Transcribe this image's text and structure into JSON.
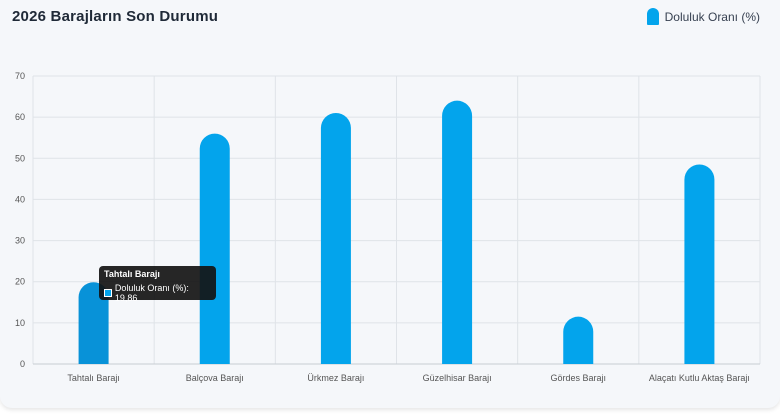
{
  "header": {
    "title": "2026 Barajların Son Durumu"
  },
  "legend": {
    "label": "Doluluk Oranı (%)",
    "color": "#03a4ec"
  },
  "tooltip": {
    "title": "Tahtalı Barajı",
    "row": "Doluluk Oranı (%): 19,86"
  },
  "chart_data": {
    "type": "bar",
    "categories": [
      "Tahtalı Barajı",
      "Balçova Barajı",
      "Ürkmez Barajı",
      "Güzelhisar Barajı",
      "Gördes Barajı",
      "Alaçatı Kutlu Aktaş Barajı"
    ],
    "series": [
      {
        "name": "Doluluk Oranı (%)",
        "values": [
          19.86,
          56,
          61,
          64,
          11.5,
          48.5
        ]
      }
    ],
    "ylim": [
      0,
      70
    ],
    "yticks": [
      0,
      10,
      20,
      30,
      40,
      50,
      60,
      70
    ],
    "grid": true,
    "legend_position": "top-right",
    "highlighted_index": 0,
    "bar_color": "#03a4ec",
    "highlight_color": "#0892d8"
  }
}
